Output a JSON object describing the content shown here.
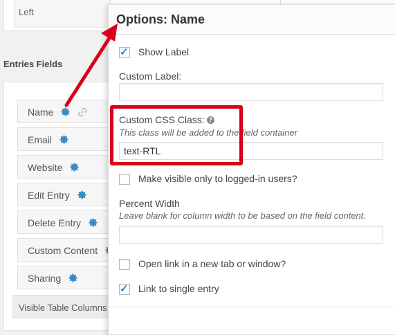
{
  "background": {
    "left_label": "Left",
    "entries_title": "Entries Fields",
    "fields": [
      {
        "label": "Name",
        "gear_icon": "gear-icon",
        "link_icon": "link-icon"
      },
      {
        "label": "Email",
        "gear_icon": "gear-icon"
      },
      {
        "label": "Website",
        "gear_icon": "gear-icon"
      },
      {
        "label": "Edit Entry",
        "gear_icon": "gear-icon"
      },
      {
        "label": "Delete Entry",
        "gear_icon": "gear-icon"
      },
      {
        "label": "Custom Content",
        "gear_icon": "gear-icon"
      },
      {
        "label": "Sharing",
        "gear_icon": "gear-icon"
      }
    ],
    "visible_columns_label": "Visible Table Columns"
  },
  "dialog": {
    "title": "Options: Name",
    "show_label": {
      "label": "Show Label",
      "checked": true
    },
    "custom_label": {
      "label": "Custom Label:",
      "value": ""
    },
    "custom_css": {
      "label": "Custom CSS Class:",
      "help_icon": "question-icon",
      "description": "This class will be added to the field container",
      "value": "text-RTL"
    },
    "logged_in_only": {
      "label": "Make visible only to logged-in users?",
      "checked": false
    },
    "percent_width": {
      "label": "Percent Width",
      "description": "Leave blank for column width to be based on the field content.",
      "value": ""
    },
    "open_new_tab": {
      "label": "Open link in a new tab or window?",
      "checked": false
    },
    "link_single_entry": {
      "label": "Link to single entry",
      "checked": true
    }
  },
  "annotation": {
    "color": "#d9001b"
  }
}
